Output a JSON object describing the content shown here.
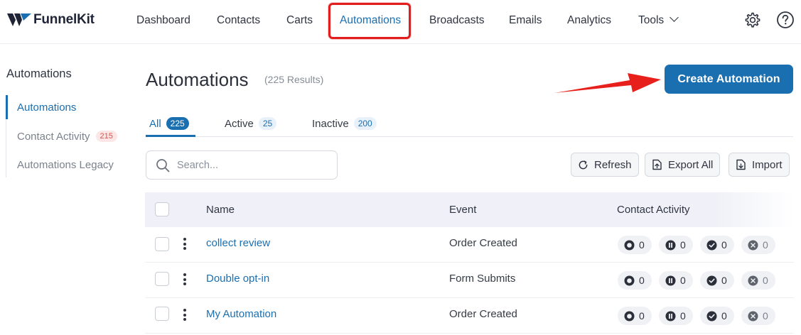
{
  "app": {
    "logo_text": "FunnelKit",
    "brand_color": "#1a6fb1"
  },
  "nav": {
    "items": [
      {
        "label": "Dashboard"
      },
      {
        "label": "Contacts"
      },
      {
        "label": "Carts"
      },
      {
        "label": "Automations",
        "active": true
      },
      {
        "label": "Broadcasts"
      },
      {
        "label": "Emails"
      },
      {
        "label": "Analytics"
      },
      {
        "label": "Tools",
        "dropdown": true
      }
    ],
    "icons": [
      "gear-icon",
      "help-icon"
    ]
  },
  "sidebar": {
    "title": "Automations",
    "items": [
      {
        "label": "Automations",
        "active": true
      },
      {
        "label": "Contact Activity",
        "badge": "215"
      },
      {
        "label": "Automations Legacy"
      }
    ]
  },
  "header": {
    "title": "Automations",
    "results": "(225 Results)",
    "create_label": "Create Automation"
  },
  "tabs": [
    {
      "label": "All",
      "count": "225",
      "active": true
    },
    {
      "label": "Active",
      "count": "25"
    },
    {
      "label": "Inactive",
      "count": "200"
    }
  ],
  "search": {
    "placeholder": "Search...",
    "value": ""
  },
  "toolbar": {
    "refresh_label": "Refresh",
    "export_label": "Export All",
    "import_label": "Import"
  },
  "table": {
    "columns": [
      "Name",
      "Event",
      "Contact Activity"
    ],
    "rows": [
      {
        "name": "collect review",
        "event": "Order Created",
        "activity": [
          "0",
          "0",
          "0",
          "0"
        ]
      },
      {
        "name": "Double opt-in",
        "event": "Form Submits",
        "activity": [
          "0",
          "0",
          "0",
          "0"
        ]
      },
      {
        "name": "My Automation",
        "event": "Order Created",
        "activity": [
          "0",
          "0",
          "0",
          "0"
        ]
      }
    ],
    "activity_icons": [
      "active-icon",
      "paused-icon",
      "completed-icon",
      "failed-icon"
    ]
  }
}
